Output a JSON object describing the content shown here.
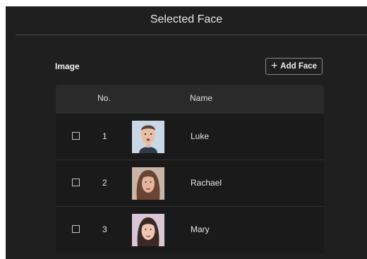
{
  "dialog": {
    "title": "Selected Face"
  },
  "section": {
    "label": "Image",
    "add_button_label": "Add Face"
  },
  "table": {
    "columns": [
      "No.",
      "Name"
    ],
    "rows": [
      {
        "no": "1",
        "name": "Luke"
      },
      {
        "no": "2",
        "name": "Rachael"
      },
      {
        "no": "3",
        "name": "Mary"
      }
    ]
  }
}
